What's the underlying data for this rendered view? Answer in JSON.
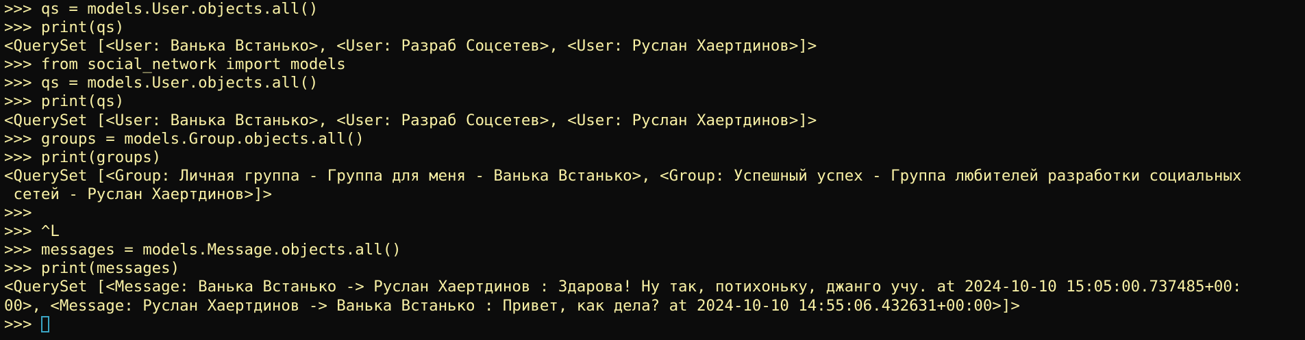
{
  "terminal": {
    "lines": [
      ">>> qs = models.User.objects.all()",
      ">>> print(qs)",
      "<QuerySet [<User: Ванька Встанько>, <User: Разраб Соцсетев>, <User: Руслан Хаертдинов>]>",
      ">>> from social_network import models",
      ">>> qs = models.User.objects.all()",
      ">>> print(qs)",
      "<QuerySet [<User: Ванька Встанько>, <User: Разраб Соцсетев>, <User: Руслан Хаертдинов>]>",
      ">>> groups = models.Group.objects.all()",
      ">>> print(groups)",
      "<QuerySet [<Group: Личная группа - Группа для меня - Ванька Встанько>, <Group: Успешный успех - Группа любителей разработки социальных",
      " сетей - Руслан Хаертдинов>]>",
      ">>>",
      ">>> ^L",
      ">>> messages = models.Message.objects.all()",
      ">>> print(messages)",
      "<QuerySet [<Message: Ванька Встанько -> Руслан Хаертдинов : Здарова! Ну так, потихоньку, джанго учу. at 2024-10-10 15:05:00.737485+00:",
      "00>, <Message: Руслан Хаертдинов -> Ванька Встанько : Привет, как дела? at 2024-10-10 14:55:06.432631+00:00>]>"
    ],
    "current_prompt": ">>> "
  }
}
